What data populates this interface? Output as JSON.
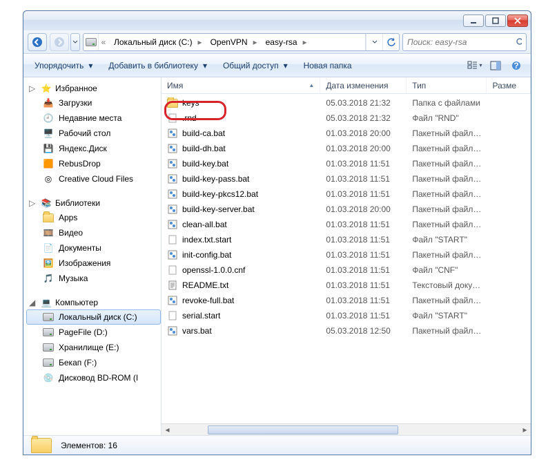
{
  "breadcrumb": [
    {
      "label": "Локальный диск (C:)"
    },
    {
      "label": "OpenVPN"
    },
    {
      "label": "easy-rsa"
    }
  ],
  "search_placeholder": "Поиск: easy-rsa",
  "toolbar": {
    "organize": "Упорядочить",
    "addlibrary": "Добавить в библиотеку",
    "share": "Общий доступ",
    "newfolder": "Новая папка"
  },
  "columns": {
    "name": "Имя",
    "date": "Дата изменения",
    "type": "Тип",
    "size": "Разме"
  },
  "sidebar": {
    "favorites": {
      "label": "Избранное",
      "items": [
        "Загрузки",
        "Недавние места",
        "Рабочий стол",
        "Яндекс.Диск",
        "RebusDrop",
        "Creative Cloud Files"
      ]
    },
    "libraries": {
      "label": "Библиотеки",
      "items": [
        "Apps",
        "Видео",
        "Документы",
        "Изображения",
        "Музыка"
      ]
    },
    "computer": {
      "label": "Компьютер",
      "items": [
        "Локальный диск (C:)",
        "PageFile (D:)",
        "Хранилище (E:)",
        "Бекап (F:)",
        "Дисковод BD-ROM (I"
      ]
    }
  },
  "files": [
    {
      "name": "keys",
      "date": "05.03.2018 21:32",
      "type": "Папка с файлами",
      "icon": "folder"
    },
    {
      "name": ".rnd",
      "date": "05.03.2018 21:32",
      "type": "Файл \"RND\"",
      "icon": "file"
    },
    {
      "name": "build-ca.bat",
      "date": "01.03.2018 20:00",
      "type": "Пакетный файл ...",
      "icon": "bat"
    },
    {
      "name": "build-dh.bat",
      "date": "01.03.2018 20:00",
      "type": "Пакетный файл ...",
      "icon": "bat"
    },
    {
      "name": "build-key.bat",
      "date": "01.03.2018 11:51",
      "type": "Пакетный файл ...",
      "icon": "bat"
    },
    {
      "name": "build-key-pass.bat",
      "date": "01.03.2018 11:51",
      "type": "Пакетный файл ...",
      "icon": "bat"
    },
    {
      "name": "build-key-pkcs12.bat",
      "date": "01.03.2018 11:51",
      "type": "Пакетный файл ...",
      "icon": "bat"
    },
    {
      "name": "build-key-server.bat",
      "date": "01.03.2018 20:00",
      "type": "Пакетный файл ...",
      "icon": "bat"
    },
    {
      "name": "clean-all.bat",
      "date": "01.03.2018 11:51",
      "type": "Пакетный файл ...",
      "icon": "bat"
    },
    {
      "name": "index.txt.start",
      "date": "01.03.2018 11:51",
      "type": "Файл \"START\"",
      "icon": "file"
    },
    {
      "name": "init-config.bat",
      "date": "01.03.2018 11:51",
      "type": "Пакетный файл ...",
      "icon": "bat"
    },
    {
      "name": "openssl-1.0.0.cnf",
      "date": "01.03.2018 11:51",
      "type": "Файл \"CNF\"",
      "icon": "file"
    },
    {
      "name": "README.txt",
      "date": "01.03.2018 11:51",
      "type": "Текстовый докум...",
      "icon": "txt"
    },
    {
      "name": "revoke-full.bat",
      "date": "01.03.2018 11:51",
      "type": "Пакетный файл ...",
      "icon": "bat"
    },
    {
      "name": "serial.start",
      "date": "01.03.2018 11:51",
      "type": "Файл \"START\"",
      "icon": "file"
    },
    {
      "name": "vars.bat",
      "date": "05.03.2018 12:50",
      "type": "Пакетный файл ...",
      "icon": "bat"
    }
  ],
  "status": {
    "count_label": "Элементов: 16"
  }
}
